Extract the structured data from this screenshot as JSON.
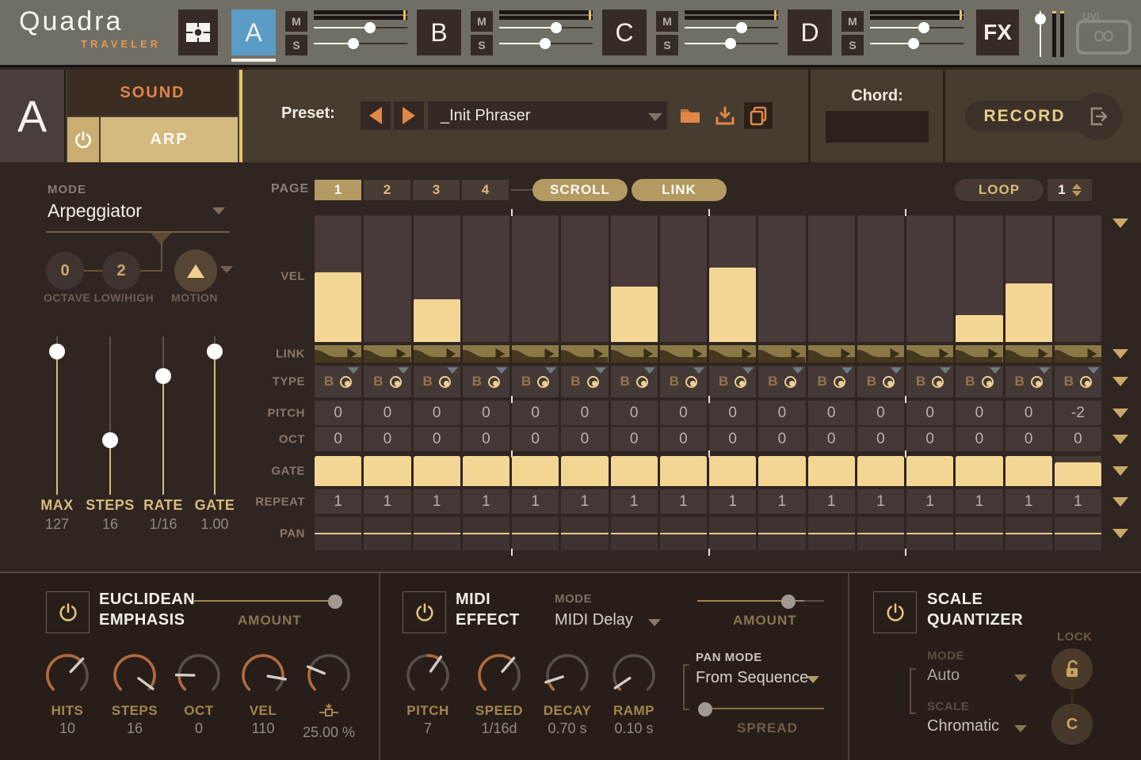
{
  "topbar": {
    "brand": "Quadra",
    "brand_sub": "TRAVELER",
    "mute_label": "M",
    "solo_label": "S",
    "fx_label": "FX",
    "uvi_label": "UVI",
    "parts": [
      {
        "label": "A",
        "active": true,
        "slider1": 0.6,
        "slider2": 0.42
      },
      {
        "label": "B",
        "active": false,
        "slider1": 0.61,
        "slider2": 0.49
      },
      {
        "label": "C",
        "active": false,
        "slider1": 0.61,
        "slider2": 0.49
      },
      {
        "label": "D",
        "active": false,
        "slider1": 0.58,
        "slider2": 0.47
      }
    ],
    "master_slider": 0.95
  },
  "header": {
    "part_letter": "A",
    "sound_tab": "SOUND",
    "arp_tab": "ARP",
    "preset_label": "Preset:",
    "preset_name": "_Init Phraser",
    "chord_label": "Chord:",
    "chord_value": "",
    "record_label": "RECORD"
  },
  "arp": {
    "mode_label": "MODE",
    "mode_value": "Arpeggiator",
    "octave_low": "0",
    "octave_high": "2",
    "octave_label": "OCTAVE LOW/HIGH",
    "motion_label": "MOTION",
    "sliders": [
      {
        "label": "MAX",
        "value": "127",
        "frac": 0.95
      },
      {
        "label": "STEPS",
        "value": "16",
        "frac": 0.33
      },
      {
        "label": "RATE",
        "value": "1/16",
        "frac": 0.78
      },
      {
        "label": "GATE",
        "value": "1.00",
        "frac": 0.95
      }
    ]
  },
  "sequencer": {
    "page_label": "PAGE",
    "pages": [
      "1",
      "2",
      "3",
      "4"
    ],
    "active_page": 0,
    "scroll_label": "SCROLL",
    "link_label": "LINK",
    "loop_label": "LOOP",
    "loop_value": "1",
    "row_labels": [
      "VEL",
      "LINK",
      "TYPE",
      "PITCH",
      "OCT",
      "GATE",
      "REPEAT",
      "PAN"
    ],
    "steps": 16,
    "type_letter": "B",
    "vel": [
      0.55,
      0,
      0.34,
      0,
      0,
      0,
      0.44,
      0,
      0.59,
      0,
      0,
      0,
      0,
      0.21,
      0.46,
      0
    ],
    "pitch": [
      "0",
      "0",
      "0",
      "0",
      "0",
      "0",
      "0",
      "0",
      "0",
      "0",
      "0",
      "0",
      "0",
      "0",
      "0",
      "-2"
    ],
    "oct": [
      "0",
      "0",
      "0",
      "0",
      "0",
      "0",
      "0",
      "0",
      "0",
      "0",
      "0",
      "0",
      "0",
      "0",
      "0",
      "0"
    ],
    "gate": [
      1,
      1,
      1,
      1,
      1,
      1,
      1,
      1,
      1,
      1,
      1,
      1,
      1,
      1,
      1,
      0.8
    ],
    "repeat": [
      "1",
      "1",
      "1",
      "1",
      "1",
      "1",
      "1",
      "1",
      "1",
      "1",
      "1",
      "1",
      "1",
      "1",
      "1",
      "1"
    ],
    "pan": [
      0,
      0,
      0,
      0,
      0,
      0,
      0,
      0,
      0,
      0,
      0,
      0,
      0,
      0,
      0,
      0
    ]
  },
  "euclidean": {
    "title_line1": "EUCLIDEAN",
    "title_line2": "EMPHASIS",
    "amount_label": "AMOUNT",
    "amount_frac": 0.97,
    "knobs": [
      {
        "label": "HITS",
        "value": "10",
        "frac": 0.66,
        "bipolar": false
      },
      {
        "label": "STEPS",
        "value": "16",
        "frac": 0.97,
        "bipolar": false
      },
      {
        "label": "OCT",
        "value": "0",
        "frac": 0.17,
        "bipolar": false
      },
      {
        "label": "VEL",
        "value": "110",
        "frac": 0.87,
        "bipolar": false
      },
      {
        "label": "",
        "icon": "humanize",
        "value": "25.00 %",
        "frac": 0.25,
        "bipolar": false
      }
    ]
  },
  "midi_effect": {
    "title_line1": "MIDI",
    "title_line2": "EFFECT",
    "mode_label": "MODE",
    "mode_value": "MIDI Delay",
    "amount_label": "AMOUNT",
    "amount_frac": 0.85,
    "knobs": [
      {
        "label": "PITCH",
        "value": "7",
        "frac": 0.63,
        "bipolar": true
      },
      {
        "label": "SPEED",
        "value": "1/16d",
        "frac": 0.65,
        "bipolar": false
      },
      {
        "label": "DECAY",
        "value": "0.70 s",
        "frac": 0.1,
        "bipolar": false
      },
      {
        "label": "RAMP",
        "value": "0.10 s",
        "frac": 0.04,
        "bipolar": false
      }
    ],
    "pan_mode_label": "PAN MODE",
    "pan_mode_value": "From Sequence",
    "spread_label": "SPREAD",
    "spread_frac": 0.0
  },
  "scale_quantizer": {
    "title_line1": "SCALE",
    "title_line2": "QUANTIZER",
    "mode_label": "MODE",
    "mode_value": "Auto",
    "scale_label": "SCALE",
    "scale_value": "Chromatic",
    "lock_label": "LOCK",
    "root_value": "C"
  },
  "colors": {
    "accent_tan": "#d9ba7c",
    "bar_gold": "#f3d693",
    "accent_orange": "#e08748",
    "active_blue": "#5b9cc7",
    "olive": "#8a7947"
  }
}
